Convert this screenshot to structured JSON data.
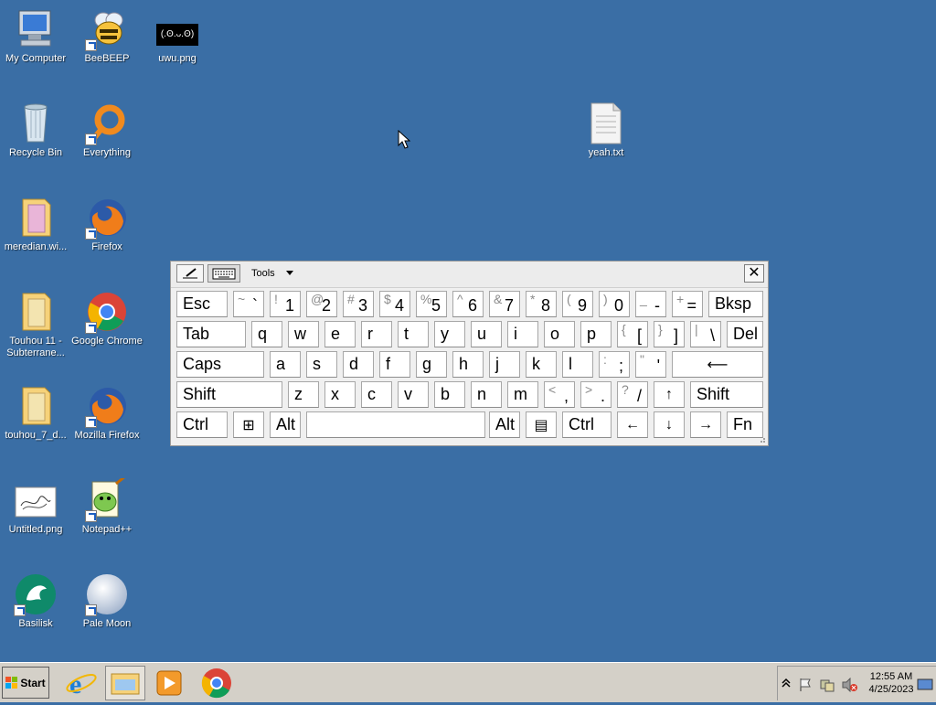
{
  "desktop": {
    "icons": [
      {
        "label": "My Computer"
      },
      {
        "label": "BeeBEEP"
      },
      {
        "label": "uwu.png"
      },
      {
        "label": "Recycle Bin"
      },
      {
        "label": "Everything"
      },
      {
        "label": "yeah.txt"
      },
      {
        "label": "meredian.wi..."
      },
      {
        "label": "Firefox"
      },
      {
        "label": "Touhou 11 -\nSubterrane..."
      },
      {
        "label": "Google Chrome"
      },
      {
        "label": "touhou_7_d..."
      },
      {
        "label": "Mozilla Firefox"
      },
      {
        "label": "Untitled.png"
      },
      {
        "label": "Notepad++"
      },
      {
        "label": "Basilisk"
      },
      {
        "label": "Pale Moon"
      }
    ],
    "uwu_text": "(.Ꙩ.ᴗ.Ꙩ)"
  },
  "osk": {
    "tools_label": "Tools",
    "close_label": "✕",
    "rows": [
      [
        {
          "main": "Esc"
        },
        {
          "sub": "~",
          "sub2": "`"
        },
        {
          "sub": "!",
          "sub2": "1"
        },
        {
          "sub": "@",
          "sub2": "2"
        },
        {
          "sub": "#",
          "sub2": "3"
        },
        {
          "sub": "$",
          "sub2": "4"
        },
        {
          "sub": "%",
          "sub2": "5"
        },
        {
          "sub": "^",
          "sub2": "6"
        },
        {
          "sub": "&",
          "sub2": "7"
        },
        {
          "sub": "*",
          "sub2": "8"
        },
        {
          "sub": "(",
          "sub2": "9"
        },
        {
          "sub": ")",
          "sub2": "0"
        },
        {
          "sub": "_",
          "sub2": "-"
        },
        {
          "sub": "+",
          "sub2": "="
        },
        {
          "main": "Bksp"
        }
      ],
      [
        {
          "main": "Tab"
        },
        {
          "main": "q"
        },
        {
          "main": "w"
        },
        {
          "main": "e"
        },
        {
          "main": "r"
        },
        {
          "main": "t"
        },
        {
          "main": "y"
        },
        {
          "main": "u"
        },
        {
          "main": "i"
        },
        {
          "main": "o"
        },
        {
          "main": "p"
        },
        {
          "sub": "{",
          "sub2": "["
        },
        {
          "sub": "}",
          "sub2": "]"
        },
        {
          "sub": "|",
          "sub2": "\\"
        },
        {
          "main": "Del"
        }
      ],
      [
        {
          "main": "Caps"
        },
        {
          "main": "a"
        },
        {
          "main": "s"
        },
        {
          "main": "d"
        },
        {
          "main": "f"
        },
        {
          "main": "g"
        },
        {
          "main": "h"
        },
        {
          "main": "j"
        },
        {
          "main": "k"
        },
        {
          "main": "l"
        },
        {
          "sub": ":",
          "sub2": ";"
        },
        {
          "sub": "\"",
          "sub2": "'"
        },
        {
          "center": "⟵"
        }
      ],
      [
        {
          "main": "Shift"
        },
        {
          "main": "z"
        },
        {
          "main": "x"
        },
        {
          "main": "c"
        },
        {
          "main": "v"
        },
        {
          "main": "b"
        },
        {
          "main": "n"
        },
        {
          "main": "m"
        },
        {
          "sub": "<",
          "sub2": ","
        },
        {
          "sub": ">",
          "sub2": "."
        },
        {
          "sub": "?",
          "sub2": "/"
        },
        {
          "center": "↑"
        },
        {
          "main": "Shift"
        }
      ],
      [
        {
          "main": "Ctrl"
        },
        {
          "center": "⊞"
        },
        {
          "main": "Alt"
        },
        {
          "main": ""
        },
        {
          "main": "Alt"
        },
        {
          "center": "▤"
        },
        {
          "main": "Ctrl"
        },
        {
          "center": "←"
        },
        {
          "center": "↓"
        },
        {
          "center": "→"
        },
        {
          "main": "Fn"
        }
      ]
    ]
  },
  "taskbar": {
    "start_label": "Start",
    "clock_time": "12:55 AM",
    "clock_date": "4/25/2023"
  }
}
